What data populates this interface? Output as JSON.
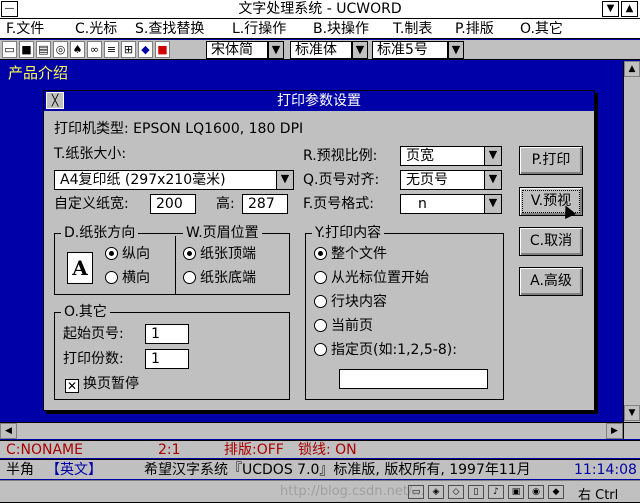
{
  "window": {
    "title": "文字处理系统 - UCWORD",
    "min_icon": "minimize-icon",
    "max_icon": "maximize-icon"
  },
  "menu": [
    {
      "label": "F.文件"
    },
    {
      "label": "C.光标"
    },
    {
      "label": "S.查找替换"
    },
    {
      "label": "L.行操作"
    },
    {
      "label": "B.块操作"
    },
    {
      "label": "T.制表"
    },
    {
      "label": "P.排版"
    },
    {
      "label": "O.其它"
    }
  ],
  "toolbar": {
    "icons": [
      "new-doc-icon",
      "save-icon",
      "print-icon",
      "preview-icon",
      "find-icon",
      "replace-icon",
      "align-icon",
      "table-icon",
      "color-icon",
      "stop-icon"
    ],
    "font_name": "宋体简",
    "font_style": "标准体",
    "font_size": "标准5号"
  },
  "document": {
    "text": "产品介绍"
  },
  "dialog": {
    "title": "打印参数设置",
    "printer_label": "打印机类型: EPSON LQ1600, 180 DPI",
    "paper_size_label": "T.纸张大小:",
    "paper_size_value": "A4复印纸 (297x210毫米)",
    "custom_width_label": "自定义纸宽:",
    "custom_width_value": "200",
    "height_label": "高:",
    "height_value": "287",
    "preview_ratio_label": "R.预视比例:",
    "preview_ratio_value": "页宽",
    "page_align_label": "Q.页号对齐:",
    "page_align_value": "无页号",
    "page_format_label": "F.页号格式:",
    "page_format_value": "n",
    "orientation": {
      "title": "D.纸张方向",
      "options": [
        "纵向",
        "横向"
      ],
      "selected": 0,
      "icon_letter": "A"
    },
    "header_pos": {
      "title": "W.页眉位置",
      "options": [
        "纸张顶端",
        "纸张底端"
      ],
      "selected": 0
    },
    "print_content": {
      "title": "Y.打印内容",
      "options": [
        "整个文件",
        "从光标位置开始",
        "行块内容",
        "当前页",
        "指定页(如:1,2,5-8):"
      ],
      "selected": 0,
      "range_value": ""
    },
    "other": {
      "title": "O.其它",
      "start_page_label": "起始页号:",
      "start_page_value": "1",
      "copies_label": "打印份数:",
      "copies_value": "1",
      "pause_label": "换页暂停",
      "pause_checked": true
    },
    "buttons": {
      "print": "P.打印",
      "preview": "V.预视",
      "cancel": "C.取消",
      "advanced": "A.高级"
    }
  },
  "status": {
    "file": "C:NONAME",
    "position": "2:1",
    "layout": "排版:OFF",
    "lock": "锁线: ON",
    "mode": "半角",
    "lang": "【英文】",
    "copyright": "希望汉字系统『UCDOS 7.0』标准版, 版权所有, 1997年11月",
    "time": "11:14:08"
  },
  "taskbar": {
    "watermark": "http://blog.csdn.net/...",
    "ime": "右 Ctrl"
  },
  "colors": {
    "desktop_blue": "#0000a8",
    "doc_text": "#ffff55",
    "status_red": "#a80000",
    "gray": "#c0c0c0"
  }
}
